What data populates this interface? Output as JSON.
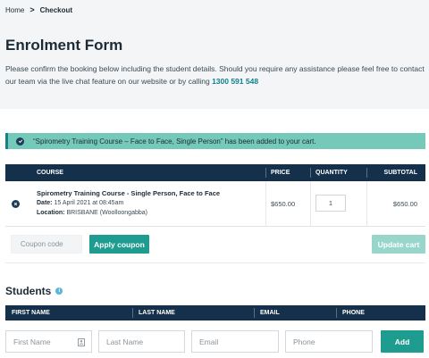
{
  "breadcrumb": {
    "home": "Home",
    "separator": ">",
    "current": "Checkout"
  },
  "page": {
    "title": "Enrolment Form",
    "intro": "Please confirm the booking below including the student details. Should you require any assistance please feel free to contact our team via the live chat feature on our website or by calling",
    "phone": "1300 591 548"
  },
  "notice": {
    "icon": "check-circle-icon",
    "message": "“Spirometry Training Course – Face to Face, Single Person” has been added to your cart."
  },
  "cart": {
    "headers": {
      "course": "COURSE",
      "price": "PRICE",
      "quantity": "QUANTITY",
      "subtotal": "SUBTOTAL"
    },
    "item": {
      "name": "Spirometry Training Course - Single Person, Face to Face",
      "date_label": "Date:",
      "date_value": "15 April 2021 at 08:45am",
      "location_label": "Location:",
      "location_value": "BRISBANE (Woolloongabba)",
      "price": "$650.00",
      "quantity": "1",
      "subtotal": "$650.00"
    },
    "coupon_placeholder": "Coupon code",
    "apply_label": "Apply coupon",
    "update_label": "Update cart"
  },
  "students": {
    "title": "Students",
    "headers": {
      "first_name": "FIRST NAME",
      "last_name": "LAST NAME",
      "email": "EMAIL",
      "phone": "PHONE"
    },
    "placeholders": {
      "first_name": "First Name",
      "last_name": "Last Name",
      "email": "Email",
      "phone": "Phone"
    },
    "add_label": "Add"
  },
  "colors": {
    "navy": "#15304a",
    "teal": "#1e9c8f",
    "notice": "#74c9b8",
    "link": "#0f7f90"
  }
}
